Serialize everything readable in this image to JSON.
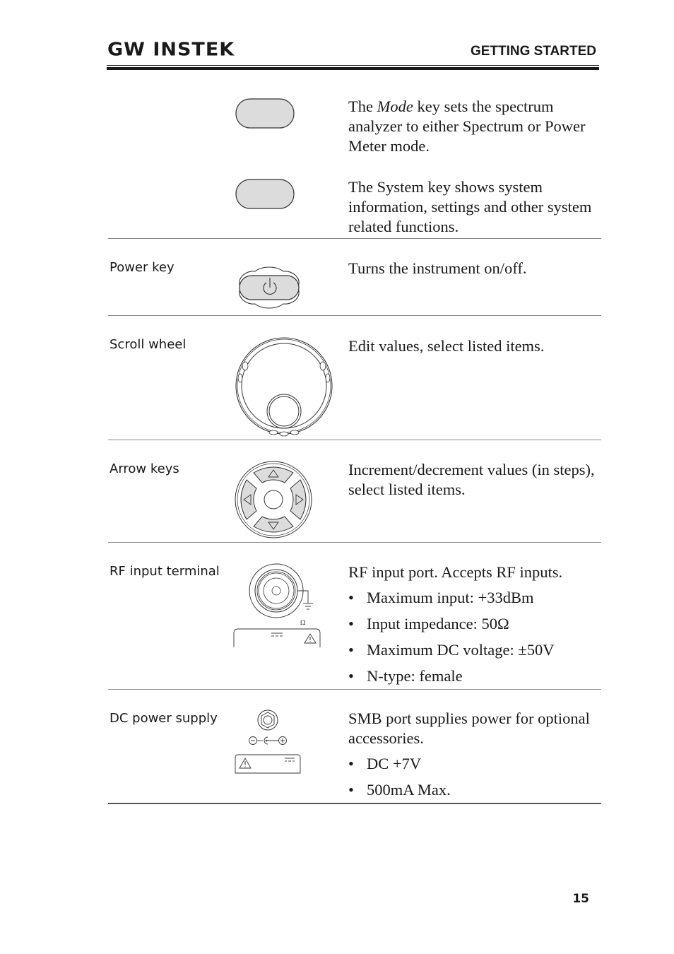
{
  "header": {
    "logo_text": "GW INSTEK",
    "section_title": "GETTING STARTED"
  },
  "rows": [
    {
      "label": "",
      "entries": [
        {
          "icon": "mode-key-icon",
          "desc_prefix": "The ",
          "desc_italic": "Mode",
          "desc_suffix": " key sets the spectrum analyzer to either Spectrum or Power Meter mode."
        },
        {
          "icon": "system-key-icon",
          "desc": "The System key shows system information, settings and other system related functions."
        }
      ]
    },
    {
      "label": "Power key",
      "icon": "power-key-icon",
      "desc": "Turns the instrument on/off."
    },
    {
      "label": "Scroll wheel",
      "icon": "scroll-wheel-icon",
      "desc": "Edit values, select listed items."
    },
    {
      "label": "Arrow keys",
      "icon": "arrow-keys-icon",
      "desc": "Increment/decrement values (in steps), select listed items."
    },
    {
      "label": "RF input terminal",
      "icon": "rf-input-terminal-icon",
      "desc": "RF input port. Accepts RF inputs.",
      "bullets": [
        "Maximum input: +33dBm",
        "Input impedance: 50Ω",
        "Maximum DC voltage: ±50V",
        "N-type: female"
      ],
      "figure_symbol": "Ω"
    },
    {
      "label": "DC power supply",
      "icon": "dc-power-supply-icon",
      "desc": "SMB port supplies power for optional accessories.",
      "bullets": [
        "DC +7V",
        "500mA Max."
      ]
    }
  ],
  "footer": {
    "page_number": "15"
  }
}
